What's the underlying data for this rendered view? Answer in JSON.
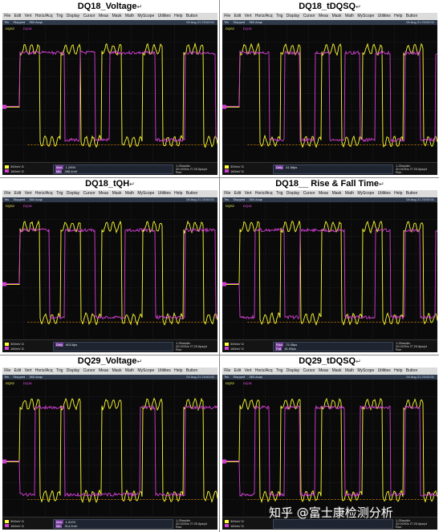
{
  "menu": [
    "File",
    "Edit",
    "Vert",
    "Horiz/Acq",
    "Trig",
    "Display",
    "Cursor",
    "Meas",
    "Mask",
    "Math",
    "MyScope",
    "Utilities",
    "Help",
    "Button"
  ],
  "status": {
    "brand": "Tek",
    "state": "Stopped",
    "acqs": "360 Acqs",
    "date": "04 Aug 21 23:02:01"
  },
  "channels": {
    "ch1": "DQS2",
    "ch2": "DQ18",
    "ch1_scale": "300mV Ω",
    "ch2_scale": "160mV Ω"
  },
  "horizontal": {
    "l1": "1.25ns/div",
    "l2": "20.0GS/s IT 25.0ps/pt",
    "l3": "Run"
  },
  "panels": [
    {
      "caption": "DQ18_Voltage",
      "meas": [
        "Max",
        "Min",
        "High",
        "Low"
      ],
      "values": [
        "1.299V",
        "288.4mV",
        "1.225V",
        "354.4mV"
      ]
    },
    {
      "caption": "DQ18_tDQSQ",
      "meas": [
        "Dely"
      ],
      "values": [
        "41.58ps"
      ]
    },
    {
      "caption": "DQ18_tQH",
      "meas": [
        "Dely"
      ],
      "values": [
        "603.8ps"
      ]
    },
    {
      "caption": "DQ18__ Rise & Fall Time",
      "meas": [
        "Rise",
        "Fall"
      ],
      "values": [
        "72.05ps",
        "81.99ps"
      ]
    },
    {
      "caption": "DQ29_Voltage",
      "meas": [
        "Max",
        "Min",
        "High",
        "Low"
      ],
      "values": [
        "1.312V",
        "314.2mV",
        "1.212V",
        "335.2mV"
      ]
    },
    {
      "caption": "DQ29_tDQSQ",
      "meas": [],
      "values": []
    }
  ],
  "caption_mark": "↵",
  "watermark": "知乎 @富士康检测分析",
  "colors": {
    "ch1": "#ffff33",
    "ch2": "#d23fd2",
    "background": "#0a0a0a",
    "grid": "#3a3a3a"
  }
}
